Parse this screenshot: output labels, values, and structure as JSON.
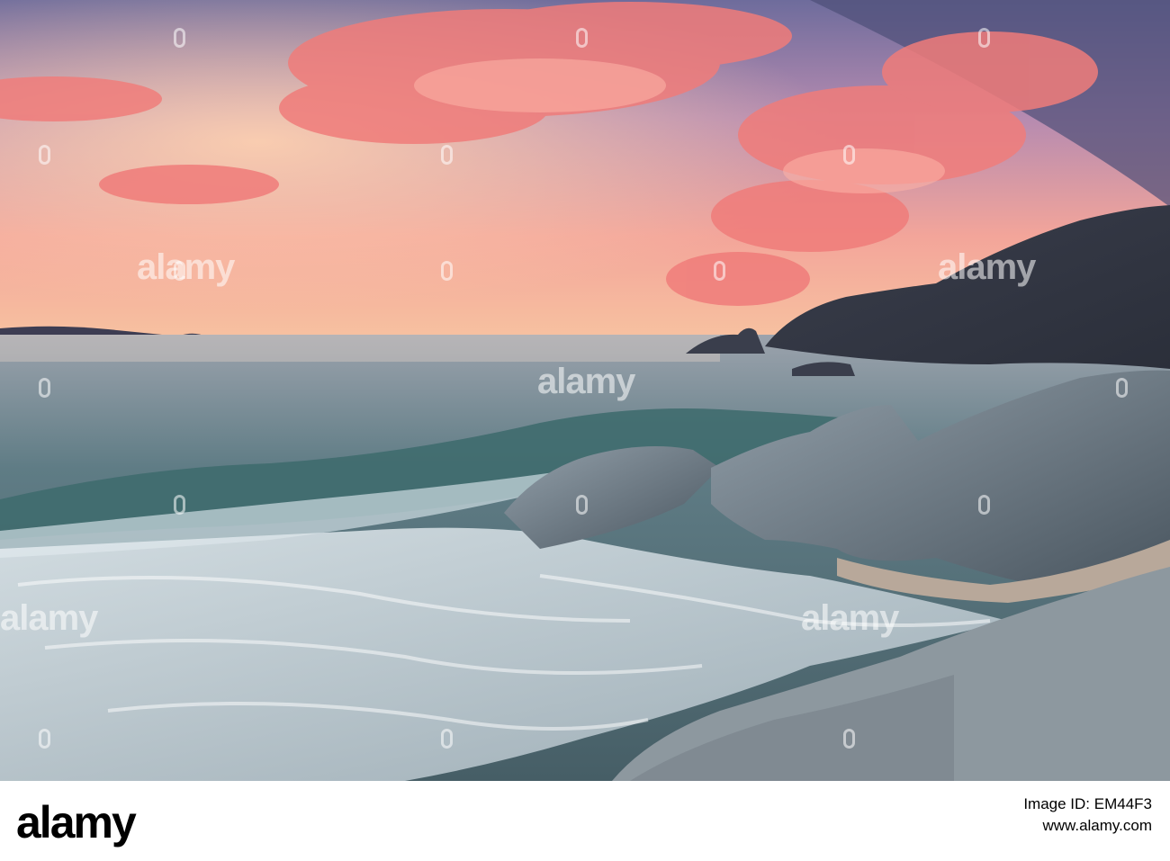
{
  "image": {
    "scene": "sunset-seascape",
    "colors": {
      "sky_pink": "#f08a86",
      "sky_purple": "#6e6c9c",
      "sea": "#4f6f7a",
      "rock": "#7a8a96"
    }
  },
  "watermark": {
    "text": "alamy"
  },
  "footer": {
    "logo": "alamy",
    "image_id_line": "Image ID: EM44F3",
    "site": "www.alamy.com"
  }
}
